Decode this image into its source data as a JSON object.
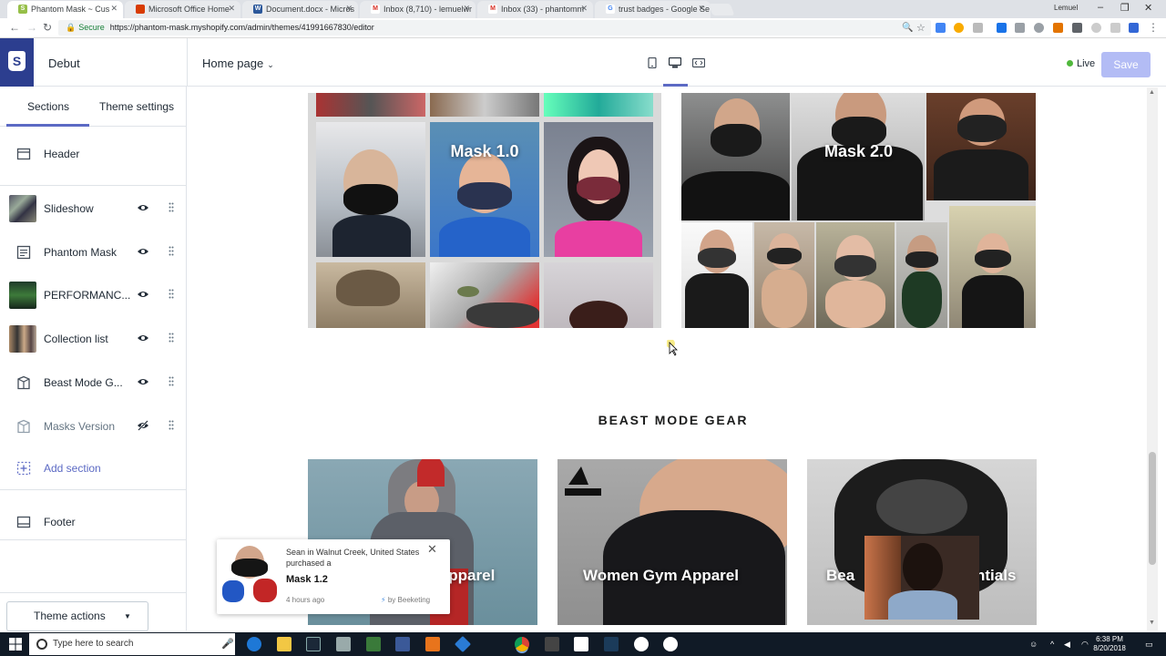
{
  "browser": {
    "tabs": [
      {
        "label": "Phantom Mask ~ Cus",
        "active": true,
        "icon": "shopify-favicon",
        "color": "#96bf48"
      },
      {
        "label": "Microsoft Office Home",
        "active": false,
        "icon": "office-favicon",
        "color": "#d83b01"
      },
      {
        "label": "Document.docx - Micros",
        "active": false,
        "icon": "word-favicon",
        "color": "#2b579a"
      },
      {
        "label": "Inbox (8,710) - lemuelwr",
        "active": false,
        "icon": "gmail-favicon",
        "color": "#d93025"
      },
      {
        "label": "Inbox (33) - phantomm",
        "active": false,
        "icon": "gmail-favicon",
        "color": "#d93025"
      },
      {
        "label": "trust badges - Google Se",
        "active": false,
        "icon": "google-favicon",
        "color": "#4285f4"
      }
    ],
    "user_label": "Lemuel",
    "secure_label": "Secure",
    "url": "https://phantom-mask.myshopify.com/admin/themes/41991667830/editor"
  },
  "editor": {
    "theme_name": "Debut",
    "page_select": "Home page",
    "status": "Live",
    "save_label": "Save",
    "colors": {
      "accent": "#5c6ac4",
      "live": "#50b83c",
      "save_disabled": "#b3bcf5",
      "shopify_nav": "#2c3e8f"
    }
  },
  "sidebar": {
    "tabs": [
      "Sections",
      "Theme settings"
    ],
    "items": [
      {
        "label": "Header"
      },
      {
        "label": "Slideshow"
      },
      {
        "label": "Phantom Mask"
      },
      {
        "label": "PERFORMANC..."
      },
      {
        "label": "Collection list"
      },
      {
        "label": "Beast Mode G..."
      },
      {
        "label": "Masks Version"
      },
      {
        "label": "Add section"
      },
      {
        "label": "Footer"
      }
    ],
    "theme_actions": "Theme actions"
  },
  "preview": {
    "collections": [
      {
        "title": "Mask 1.0"
      },
      {
        "title": "Mask 2.0"
      }
    ],
    "gear_heading": "BEAST MODE GEAR",
    "products": [
      {
        "label": "Apparel"
      },
      {
        "label": "Women Gym Apparel"
      },
      {
        "label_left": "Bea",
        "label_right": "ntials"
      }
    ],
    "notification": {
      "line1": "Sean in Walnut Creek, United States",
      "line2": "purchased a",
      "product": "Mask 1.2",
      "time": "4 hours ago",
      "by": "by Beeketing"
    }
  },
  "taskbar": {
    "search_placeholder": "Type here to search",
    "time": "6:38 PM",
    "date": "8/20/2018"
  }
}
